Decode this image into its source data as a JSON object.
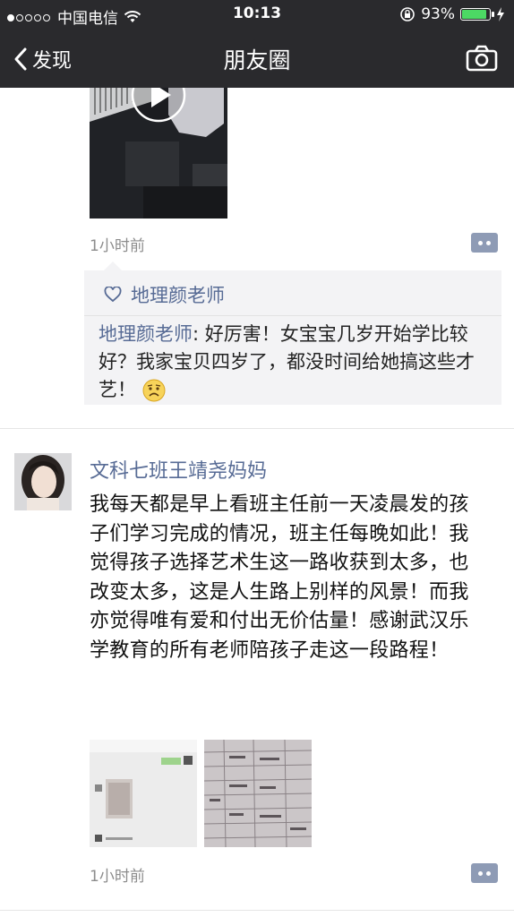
{
  "status_bar": {
    "carrier": "中国电信",
    "time": "10:13",
    "battery": "93%",
    "battery_level": 0.93
  },
  "nav": {
    "back_label": "发现",
    "title": "朋友圈"
  },
  "post1": {
    "time": "1小时前",
    "likes": "地理颜老师",
    "comment_author": "地理颜老师",
    "comment_text": ": 好厉害！女宝宝几岁开始学比较好？我家宝贝四岁了，都没时间给她搞这些才艺！"
  },
  "post2": {
    "author": "文科七班王靖尧妈妈",
    "text": "我每天都是早上看班主任前一天凌晨发的孩子们学习完成的情况，班主任每晚如此！我觉得孩子选择艺术生这一路收获到太多，也改变太多，这是人生路上别样的风景！而我亦觉得唯有爱和付出无价估量！感谢武汉乐学教育的所有老师陪孩子走这一段路程！",
    "time": "1小时前"
  },
  "colors": {
    "bar": "#2a2a2d",
    "link": "#576b95",
    "battery": "#4cd964"
  }
}
